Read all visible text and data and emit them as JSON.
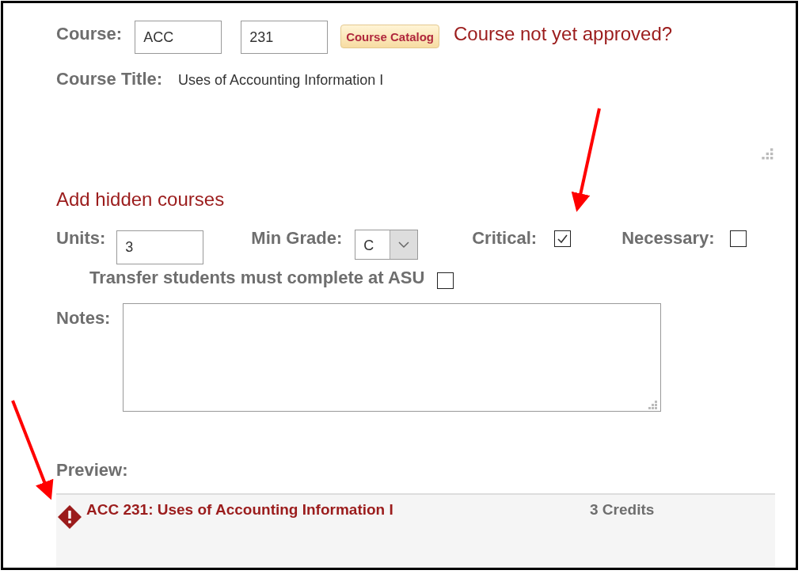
{
  "course": {
    "label": "Course:",
    "subject": "ACC",
    "number": "231",
    "catalog_button": "Course Catalog",
    "not_approved_link": "Course not yet approved?"
  },
  "course_title": {
    "label": "Course Title:",
    "value": "Uses of Accounting Information I"
  },
  "add_hidden_link": "Add hidden courses",
  "units": {
    "label": "Units:",
    "value": "3"
  },
  "min_grade": {
    "label": "Min Grade:",
    "value": "C"
  },
  "critical": {
    "label": "Critical:",
    "checked": true
  },
  "necessary": {
    "label": "Necessary:",
    "checked": false
  },
  "transfer": {
    "label": "Transfer students must complete at ASU",
    "checked": false
  },
  "notes": {
    "label": "Notes:"
  },
  "preview": {
    "label": "Preview:",
    "title": "ACC 231: Uses of Accounting Information I",
    "credits": "3 Credits",
    "warning": true
  }
}
